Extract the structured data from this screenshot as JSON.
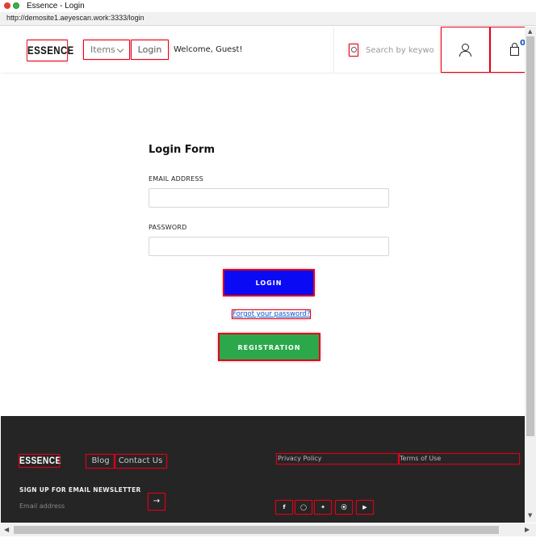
{
  "window": {
    "title": "Essence - Login",
    "url": "http://demosite1.aeyescan.work:3333/login"
  },
  "header": {
    "logo": "ESSENCE",
    "nav_items_label": "Items",
    "nav_login_label": "Login",
    "welcome_text": "Welcome, Guest!",
    "search_placeholder": "Search by keyword",
    "cart_count": "0"
  },
  "login_form": {
    "title": "Login Form",
    "email_label": "EMAIL ADDRESS",
    "email_value": "",
    "password_label": "PASSWORD",
    "password_value": "",
    "login_button": "LOGIN",
    "forgot_link": "Forgot your password?",
    "registration_button": "REGISTRATION"
  },
  "footer": {
    "logo": "ESSENCE",
    "nav": [
      {
        "label": "Blog"
      },
      {
        "label": "Contact Us"
      }
    ],
    "links": [
      {
        "label": "Privacy Policy"
      },
      {
        "label": "Terms of Use"
      }
    ],
    "newsletter_title": "SIGN UP FOR EMAIL NEWSLETTER",
    "newsletter_placeholder": "Email address",
    "newsletter_button_icon": "arrow-right-icon",
    "social_icons": [
      "facebook-icon",
      "instagram-icon",
      "twitter-icon",
      "pinterest-icon",
      "youtube-icon"
    ]
  },
  "colors": {
    "login_button": "#0a0af5",
    "registration_button": "#2ba84a",
    "footer_background": "#252525",
    "highlight": "#e0001b",
    "link": "#0a53c8"
  }
}
